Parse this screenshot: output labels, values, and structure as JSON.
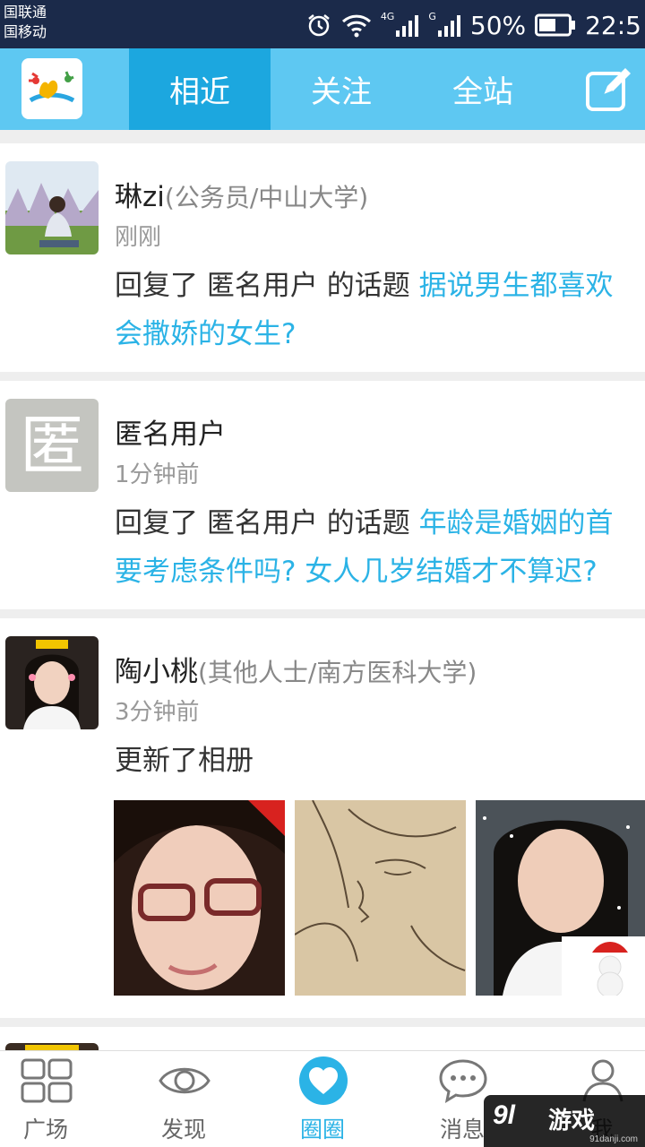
{
  "status_bar": {
    "carrier_1": "国联通",
    "carrier_2": "国移动",
    "network_1": "4G",
    "network_2": "G",
    "battery": "50%",
    "time": "22:5"
  },
  "header": {
    "tabs": [
      {
        "label": "相近",
        "active": true
      },
      {
        "label": "关注",
        "active": false
      },
      {
        "label": "全站",
        "active": false
      }
    ],
    "accent": "#5ec8f2",
    "active_tab_color": "#1ca7df"
  },
  "feed": [
    {
      "name": "琳zi",
      "meta": "(公务员/中山大学)",
      "time": "刚刚",
      "action": "回复了 匿名用户 的话题 ",
      "topic": "据说男生都喜欢会撒娇的女生?"
    },
    {
      "name": "匿名用户",
      "meta": "",
      "time": "1分钟前",
      "avatar_char": "匿",
      "action": "回复了 匿名用户 的话题 ",
      "topic": "年龄是婚姻的首要考虑条件吗? 女人几岁结婚才不算迟?"
    },
    {
      "name": "陶小桃",
      "meta": "(其他人士/南方医科大学)",
      "time": "3分钟前",
      "action": "更新了相册"
    }
  ],
  "bottom_nav": [
    {
      "label": "广场",
      "icon": "grid-icon",
      "active": false
    },
    {
      "label": "发现",
      "icon": "eye-icon",
      "active": false
    },
    {
      "label": "圈圈",
      "icon": "heart-icon",
      "active": true
    },
    {
      "label": "消息",
      "icon": "chat-icon",
      "active": false
    },
    {
      "label": "我",
      "icon": "person-icon",
      "active": false
    }
  ],
  "watermark": {
    "logo": "9l",
    "text": "游戏",
    "url": "91danji.com"
  }
}
